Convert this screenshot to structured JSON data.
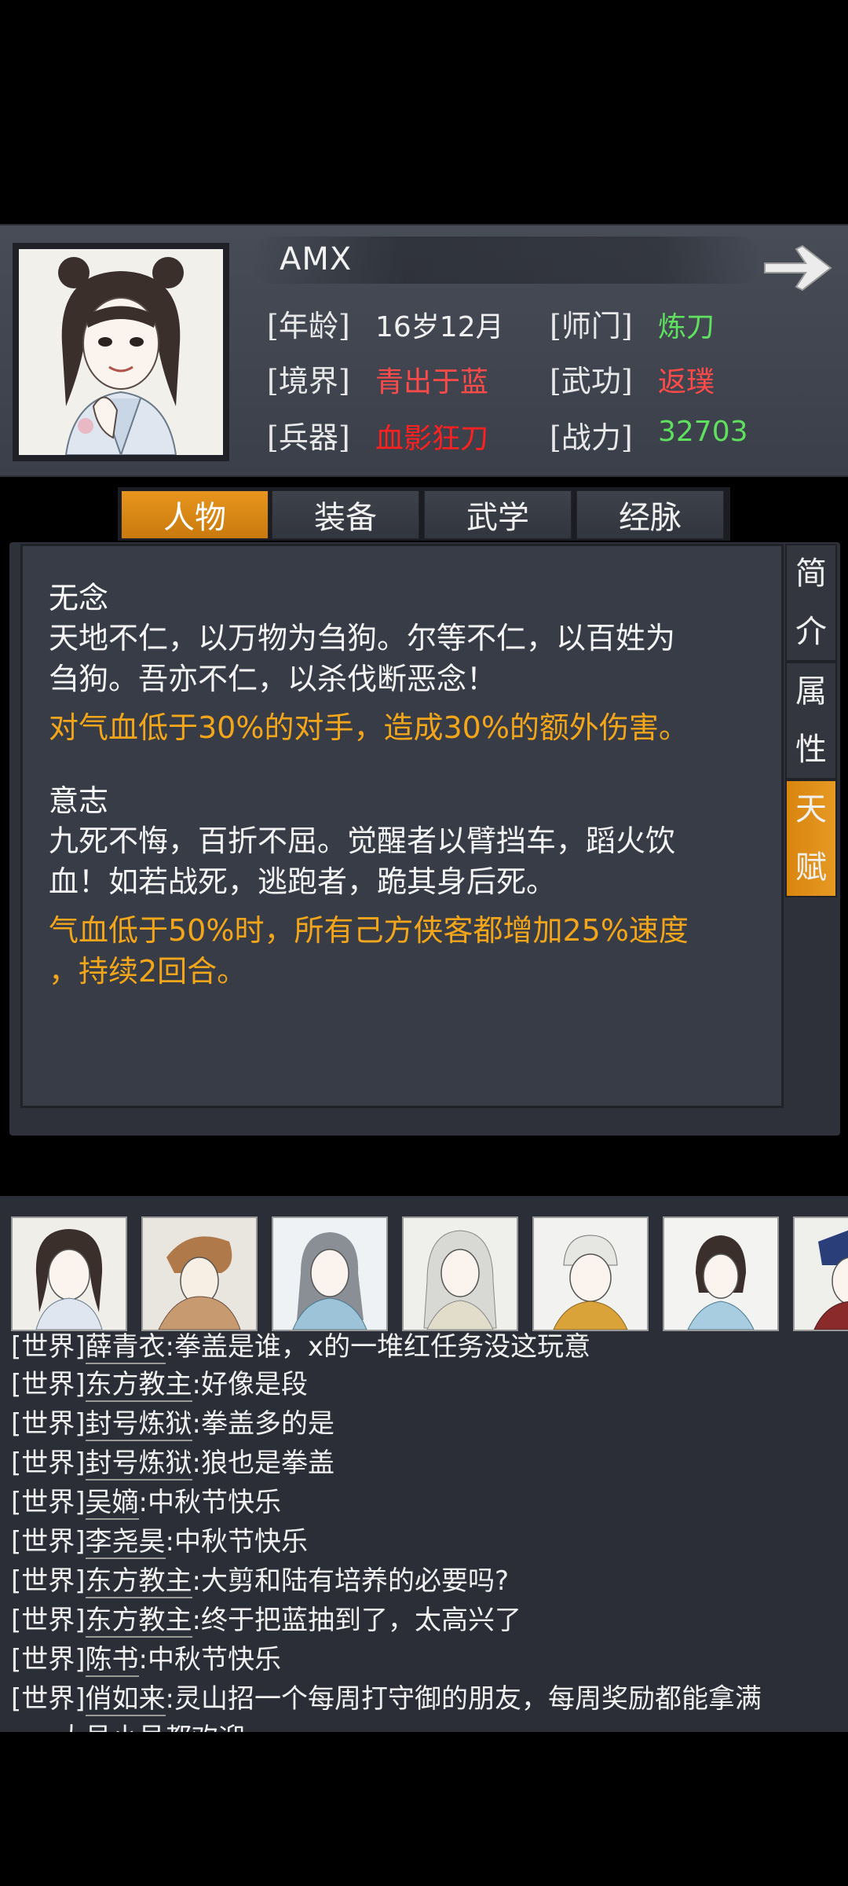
{
  "player": {
    "name": "AMX",
    "stats": [
      {
        "label": "[年龄]",
        "value": "16岁12月",
        "color": "#f0f0f0"
      },
      {
        "label": "[师门]",
        "value": "炼刀",
        "color": "#5fe05f"
      },
      {
        "label": "[境界]",
        "value": "青出于蓝",
        "color": "#ff4a4a"
      },
      {
        "label": "[武功]",
        "value": "返璞",
        "color": "#ff4a4a"
      },
      {
        "label": "[兵器]",
        "value": "血影狂刀",
        "color": "#ff2020"
      },
      {
        "label": "[战力]",
        "value": "32703",
        "color": "#5fe05f"
      }
    ]
  },
  "tabs": [
    {
      "label": "人物",
      "active": true
    },
    {
      "label": "装备",
      "active": false
    },
    {
      "label": "武学",
      "active": false
    },
    {
      "label": "经脉",
      "active": false
    }
  ],
  "side_tabs": [
    {
      "chars": [
        "简",
        "介"
      ],
      "active": false
    },
    {
      "chars": [
        "属",
        "性"
      ],
      "active": false
    },
    {
      "chars": [
        "天",
        "赋"
      ],
      "active": true
    }
  ],
  "talents": [
    {
      "title": "无念",
      "desc_lines": [
        "天地不仁，以万物为刍狗。尔等不仁，以百姓为",
        "刍狗。吾亦不仁，以杀伐断恶念！"
      ],
      "effect_lines": [
        "对气血低于30%的对手，造成30%的额外伤害。"
      ]
    },
    {
      "title": "意志",
      "desc_lines": [
        "九死不悔，百折不屈。觉醒者以臂挡车，蹈火饮",
        "血！如若战死，逃跑者，跪其身后死。"
      ],
      "effect_lines": [
        "气血低于50%时，所有己方侠客都增加25%速度",
        "，持续2回合。"
      ]
    }
  ],
  "chat": [
    {
      "channel": "[世界]",
      "user": "薛青衣",
      "msg": ":拳盖是谁，x的一堆红任务没这玩意"
    },
    {
      "channel": "[世界]",
      "user": "东方教主",
      "msg": ":好像是段"
    },
    {
      "channel": "[世界]",
      "user": "封号炼狱",
      "msg": ":拳盖多的是"
    },
    {
      "channel": "[世界]",
      "user": "封号炼狱",
      "msg": ":狼也是拳盖"
    },
    {
      "channel": "[世界]",
      "user": "吴嫡",
      "msg": ":中秋节快乐"
    },
    {
      "channel": "[世界]",
      "user": "李尧昊",
      "msg": ":中秋节快乐"
    },
    {
      "channel": "[世界]",
      "user": "东方教主",
      "msg": ":大剪和陆有培养的必要吗?"
    },
    {
      "channel": "[世界]",
      "user": "东方教主",
      "msg": ":终于把蓝抽到了，太高兴了"
    },
    {
      "channel": "[世界]",
      "user": "陈书",
      "msg": ":中秋节快乐"
    },
    {
      "channel": "[世界]",
      "user": "俏如来",
      "msg": ":灵山招一个每周打守御的朋友，每周奖励都能拿满"
    },
    {
      "channel": "",
      "user": "",
      "msg": "，大号小号都欢迎"
    }
  ]
}
